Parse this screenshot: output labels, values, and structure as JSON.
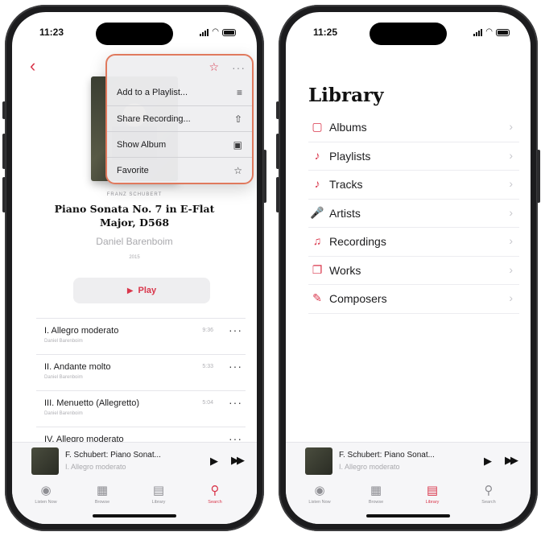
{
  "left_phone": {
    "status": {
      "time": "11:23"
    },
    "menu": {
      "items": [
        {
          "label": "Add to a Playlist...",
          "icon": "playlist-add-icon",
          "glyph": "≡"
        },
        {
          "label": "Share Recording...",
          "icon": "share-icon",
          "glyph": "⇧"
        },
        {
          "label": "Show Album",
          "icon": "album-icon",
          "glyph": "▣"
        },
        {
          "label": "Favorite",
          "icon": "star-outline-icon",
          "glyph": "☆"
        }
      ]
    },
    "album": {
      "composer": "FRANZ SCHUBERT",
      "title": "Piano Sonata No. 7 in E-Flat Major, D568",
      "artist": "Daniel Barenboim",
      "year": "2015"
    },
    "play_label": "Play",
    "tracks": [
      {
        "name": "I. Allegro moderato",
        "artist": "Daniel Barenboim",
        "duration": "9:36"
      },
      {
        "name": "II. Andante molto",
        "artist": "Daniel Barenboim",
        "duration": "5:33"
      },
      {
        "name": "III. Menuetto (Allegretto)",
        "artist": "Daniel Barenboim",
        "duration": "5:04"
      },
      {
        "name": "IV. Allegro moderato",
        "artist": "",
        "duration": ""
      }
    ],
    "now_playing": {
      "title": "F. Schubert: Piano Sonat...",
      "subtitle": "I. Allegro moderato"
    },
    "tabs": [
      {
        "label": "Listen Now",
        "icon": "listen-now-icon",
        "glyph": "◉"
      },
      {
        "label": "Browse",
        "icon": "browse-icon",
        "glyph": "▦"
      },
      {
        "label": "Library",
        "icon": "library-icon",
        "glyph": "▤"
      },
      {
        "label": "Search",
        "icon": "search-icon",
        "glyph": "⚲"
      }
    ],
    "active_tab": "Search"
  },
  "right_phone": {
    "status": {
      "time": "11:25"
    },
    "title": "Library",
    "items": [
      {
        "label": "Albums",
        "icon": "albums-icon",
        "glyph": "▢"
      },
      {
        "label": "Playlists",
        "icon": "playlists-icon",
        "glyph": "♪"
      },
      {
        "label": "Tracks",
        "icon": "tracks-icon",
        "glyph": "♪"
      },
      {
        "label": "Artists",
        "icon": "artists-icon",
        "glyph": "🎤"
      },
      {
        "label": "Recordings",
        "icon": "recordings-icon",
        "glyph": "♫"
      },
      {
        "label": "Works",
        "icon": "works-icon",
        "glyph": "❐"
      },
      {
        "label": "Composers",
        "icon": "composers-icon",
        "glyph": "✎"
      }
    ],
    "now_playing": {
      "title": "F. Schubert: Piano Sonat...",
      "subtitle": "I. Allegro moderato"
    },
    "tabs": [
      {
        "label": "Listen Now",
        "icon": "listen-now-icon",
        "glyph": "◉"
      },
      {
        "label": "Browse",
        "icon": "browse-icon",
        "glyph": "▦"
      },
      {
        "label": "Library",
        "icon": "library-icon",
        "glyph": "▤"
      },
      {
        "label": "Search",
        "icon": "search-icon",
        "glyph": "⚲"
      }
    ],
    "active_tab": "Library"
  },
  "colors": {
    "accent": "#d9364b",
    "menu_outline": "#e0795d",
    "text": "#1c1c1e",
    "secondary": "#a9a9ad"
  }
}
